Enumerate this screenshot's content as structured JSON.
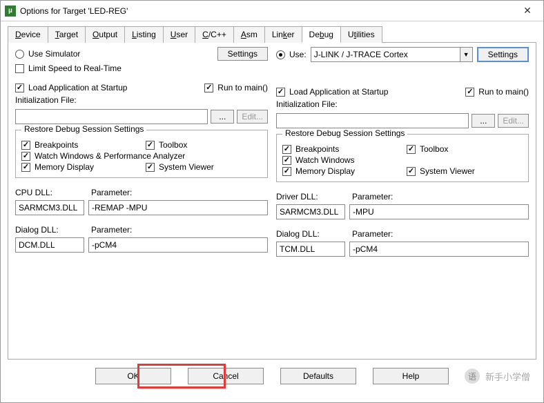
{
  "window": {
    "title": "Options for Target 'LED-REG'"
  },
  "tabs": {
    "items": [
      {
        "label": "Device"
      },
      {
        "label": "Target"
      },
      {
        "label": "Output"
      },
      {
        "label": "Listing"
      },
      {
        "label": "User"
      },
      {
        "label": "C/C++"
      },
      {
        "label": "Asm"
      },
      {
        "label": "Linker"
      },
      {
        "label": "Debug"
      },
      {
        "label": "Utilities"
      }
    ],
    "active": "Debug"
  },
  "left": {
    "use_sim": "Use Simulator",
    "settings": "Settings",
    "limit_speed": "Limit Speed to Real-Time",
    "load_app": "Load Application at Startup",
    "run_main": "Run to main()",
    "init_label": "Initialization File:",
    "init_value": "",
    "browse": "...",
    "edit": "Edit...",
    "restore_title": "Restore Debug Session Settings",
    "breakpoints": "Breakpoints",
    "toolbox": "Toolbox",
    "watch": "Watch Windows & Performance Analyzer",
    "memory": "Memory Display",
    "sysview": "System Viewer",
    "cpu_dll_label": "CPU DLL:",
    "cpu_param_label": "Parameter:",
    "cpu_dll": "SARMCM3.DLL",
    "cpu_param": "-REMAP -MPU",
    "dlg_dll_label": "Dialog DLL:",
    "dlg_param_label": "Parameter:",
    "dlg_dll": "DCM.DLL",
    "dlg_param": "-pCM4"
  },
  "right": {
    "use": "Use:",
    "driver": "J-LINK / J-TRACE Cortex",
    "settings": "Settings",
    "load_app": "Load Application at Startup",
    "run_main": "Run to main()",
    "init_label": "Initialization File:",
    "init_value": "",
    "browse": "...",
    "edit": "Edit...",
    "restore_title": "Restore Debug Session Settings",
    "breakpoints": "Breakpoints",
    "toolbox": "Toolbox",
    "watch": "Watch Windows",
    "memory": "Memory Display",
    "sysview": "System Viewer",
    "drv_dll_label": "Driver DLL:",
    "drv_param_label": "Parameter:",
    "drv_dll": "SARMCM3.DLL",
    "drv_param": "-MPU",
    "dlg_dll_label": "Dialog DLL:",
    "dlg_param_label": "Parameter:",
    "dlg_dll": "TCM.DLL",
    "dlg_param": "-pCM4"
  },
  "buttons": {
    "ok": "OK",
    "cancel": "Cancel",
    "defaults": "Defaults",
    "help": "Help"
  },
  "watermark": "新手小学僧"
}
